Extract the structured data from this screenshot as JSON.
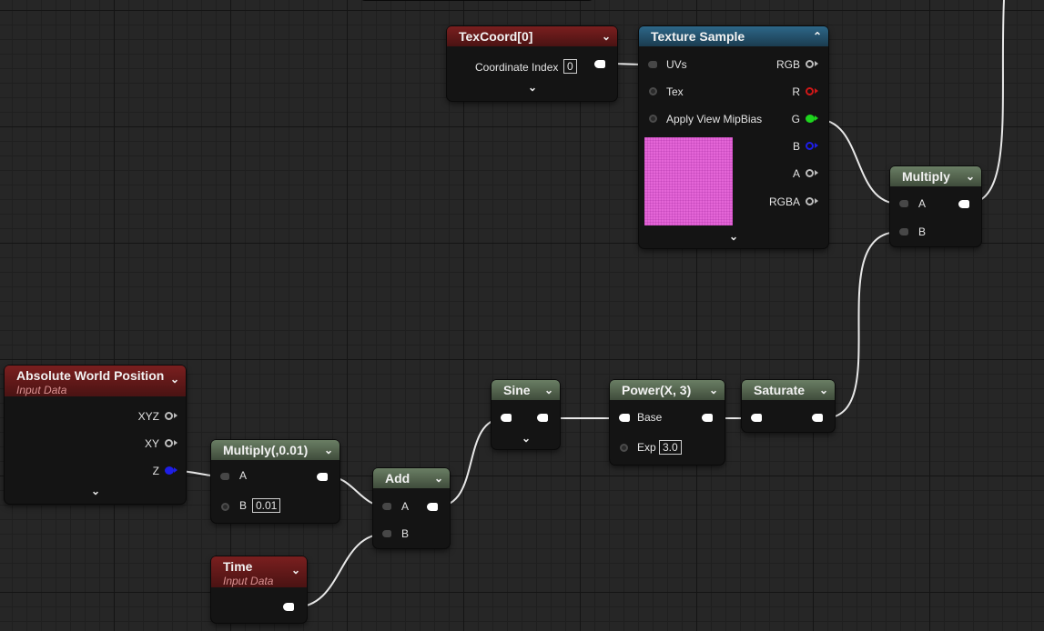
{
  "nodes": {
    "texcoord": {
      "title": "TexCoord[0]",
      "chevron": "⌄",
      "coordinate_index_label": "Coordinate Index",
      "coordinate_index_value": "0",
      "expand": "⌄"
    },
    "texture_sample": {
      "title": "Texture Sample",
      "chevron": "⌃",
      "inputs": [
        "UVs",
        "Tex",
        "Apply View MipBias"
      ],
      "outputs": [
        "RGB",
        "R",
        "G",
        "B",
        "A",
        "RGBA"
      ],
      "preview_color": "#e465d7",
      "expand": "⌄"
    },
    "multiply_top": {
      "title": "Multiply",
      "chevron": "⌄",
      "inputs": [
        "A",
        "B"
      ]
    },
    "abs_world_pos": {
      "title": "Absolute World Position",
      "subtitle": "Input Data",
      "chevron": "⌄",
      "outputs": [
        "XYZ",
        "XY",
        "Z"
      ],
      "expand": "⌄"
    },
    "multiply_small": {
      "title": "Multiply(,0.01)",
      "chevron": "⌄",
      "input_a": "A",
      "input_b": "B",
      "b_value": "0.01"
    },
    "add": {
      "title": "Add",
      "chevron": "⌄",
      "inputs": [
        "A",
        "B"
      ]
    },
    "sine": {
      "title": "Sine",
      "chevron": "⌄",
      "expand": "⌄"
    },
    "power": {
      "title": "Power(X, 3)",
      "chevron": "⌄",
      "base_label": "Base",
      "exp_label": "Exp",
      "exp_value": "3.0"
    },
    "saturate": {
      "title": "Saturate",
      "chevron": "⌄"
    },
    "time": {
      "title": "Time",
      "subtitle": "Input Data",
      "chevron": "⌄"
    }
  },
  "colors": {
    "input_header": "#7a1f1f",
    "function_header": "#6a7e64",
    "texture_header": "#2d6788",
    "pin_r": "#d01818",
    "pin_g": "#1ed51e",
    "pin_b": "#1e1ee6",
    "wire": "#e6e6e6"
  },
  "icons": [
    "chevron-down-icon",
    "chevron-up-icon",
    "expand-arrow-icon",
    "pin-icon"
  ]
}
